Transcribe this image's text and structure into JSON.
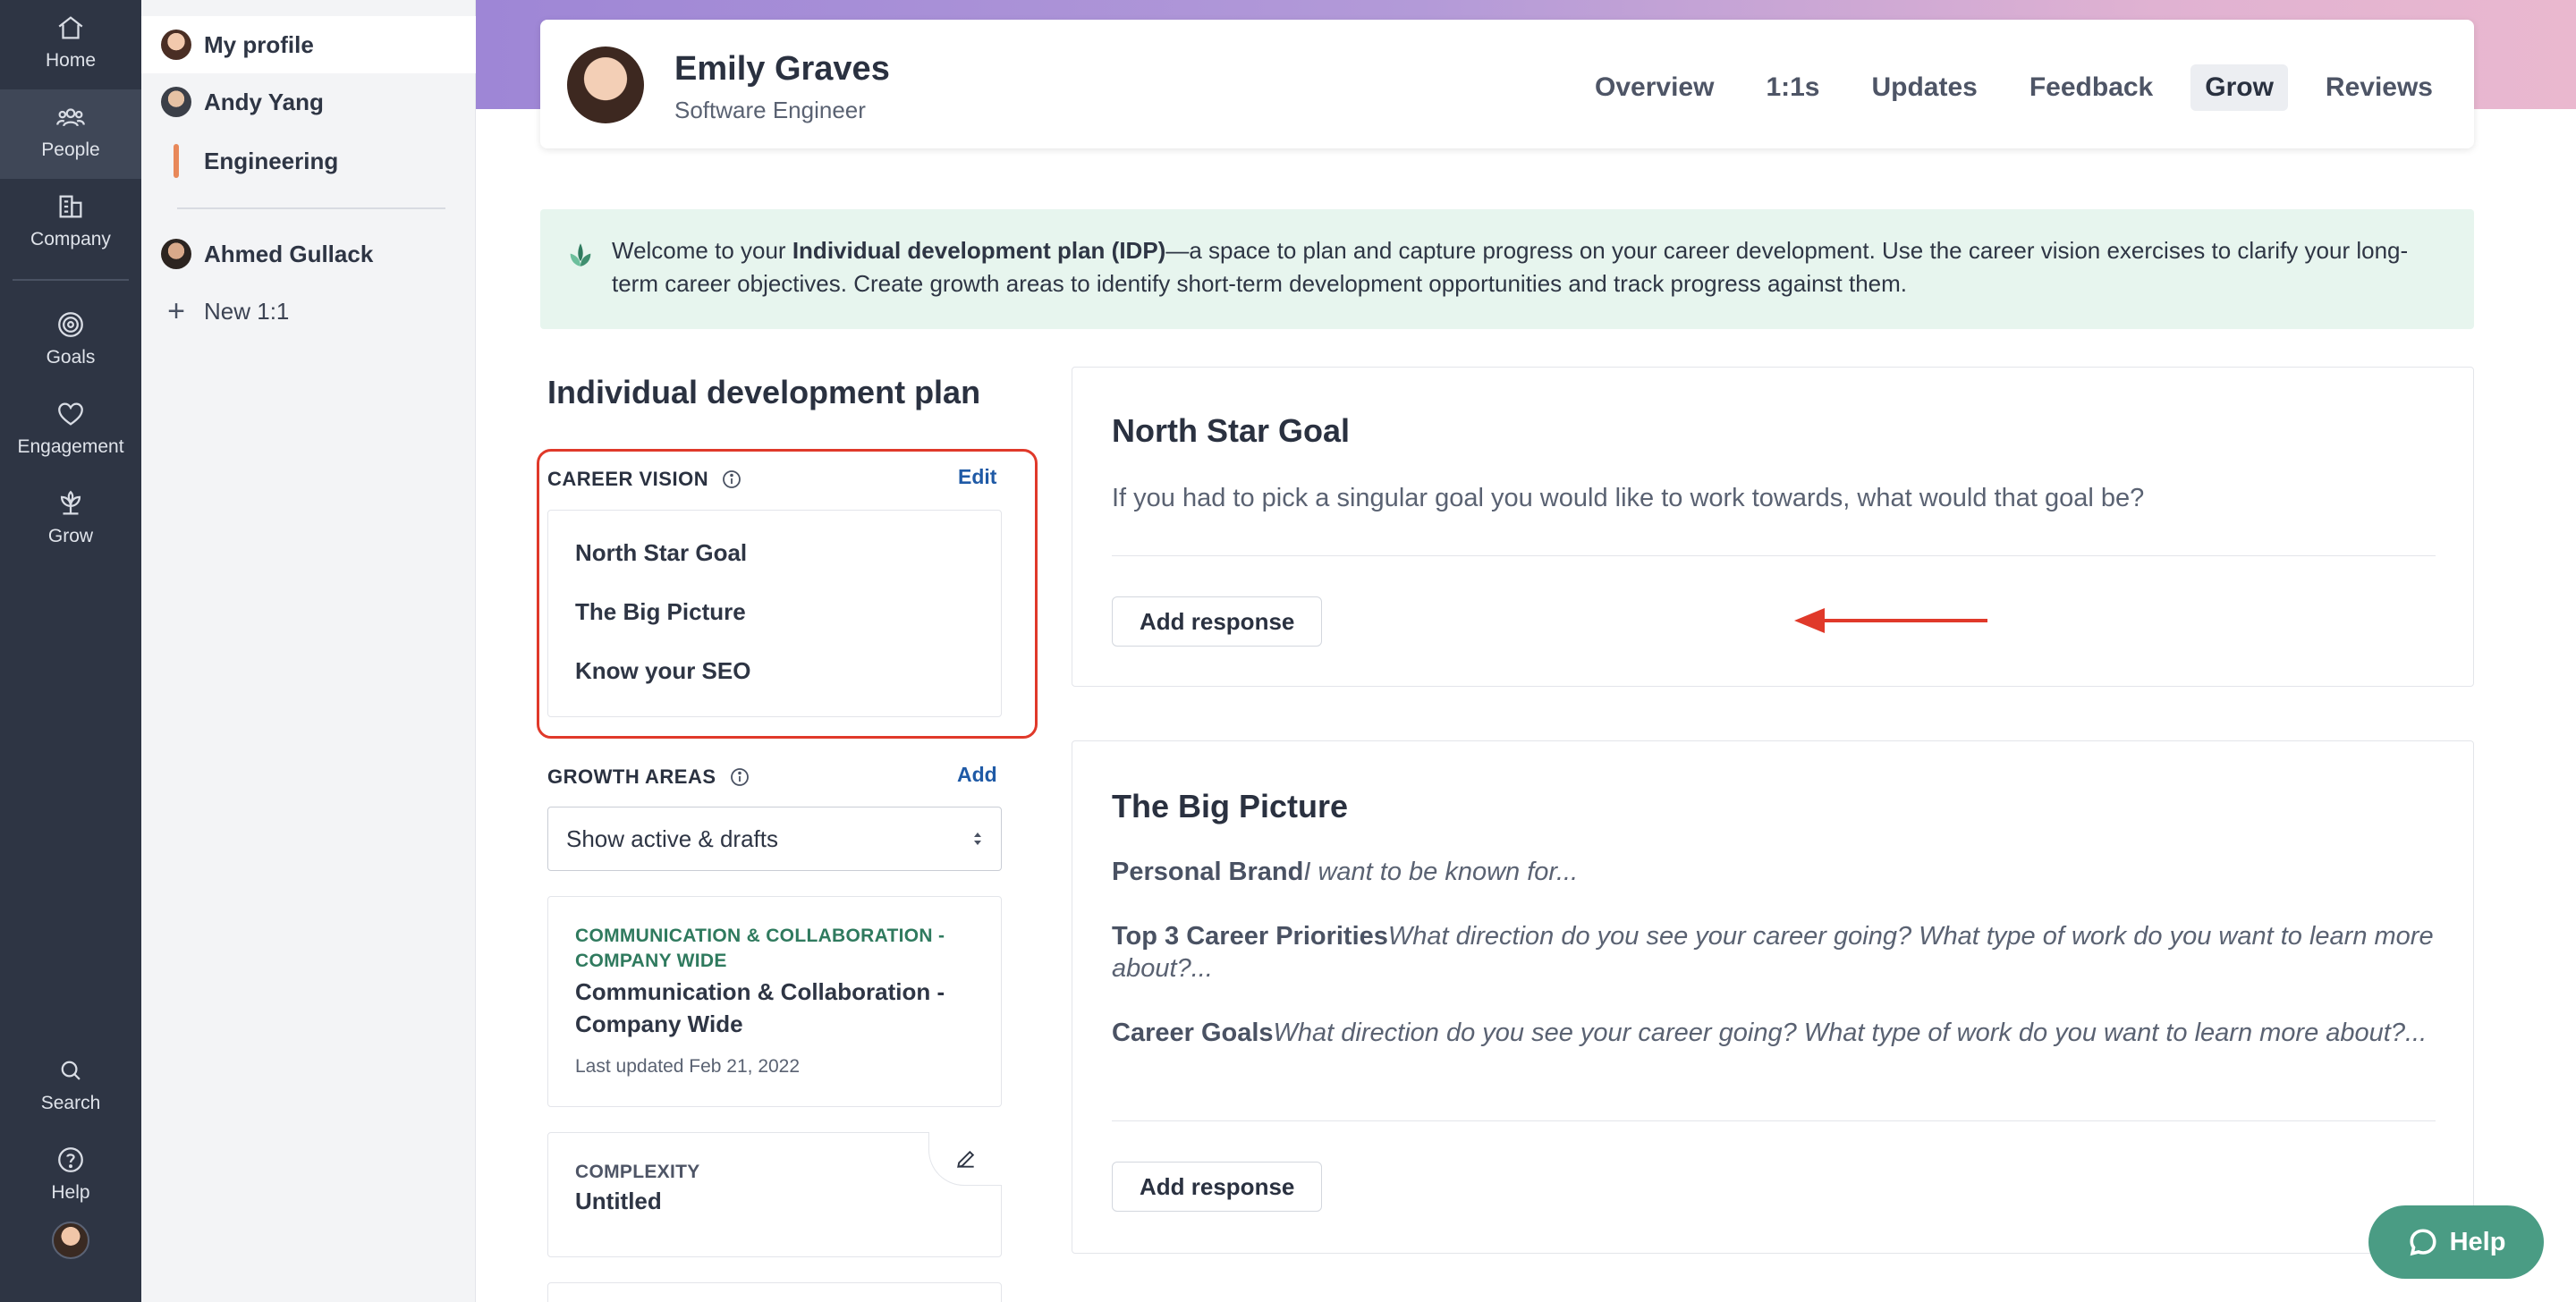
{
  "rail": {
    "home": "Home",
    "people": "People",
    "company": "Company",
    "goals": "Goals",
    "engagement": "Engagement",
    "grow": "Grow",
    "search": "Search",
    "help": "Help"
  },
  "subnav": {
    "my_profile": "My profile",
    "andy": "Andy Yang",
    "engineering": "Engineering",
    "ahmed": "Ahmed Gullack",
    "new_one_on_one": "New 1:1"
  },
  "profile": {
    "name": "Emily Graves",
    "role": "Software Engineer",
    "tabs": [
      "Overview",
      "1:1s",
      "Updates",
      "Feedback",
      "Grow",
      "Reviews"
    ],
    "active_tab": "Grow"
  },
  "welcome": {
    "prefix": "Welcome to your ",
    "bold": "Individual development plan (IDP)",
    "suffix": "—a space to plan and capture progress on your career development. Use the career vision exercises to clarify your long-term career objectives. Create growth areas to identify short-term development opportunities and track progress against them."
  },
  "idp": {
    "title": "Individual development plan",
    "career_vision": {
      "heading": "CAREER VISION",
      "edit": "Edit",
      "items": [
        "North Star Goal",
        "The Big Picture",
        "Know your SEO"
      ]
    },
    "growth_areas": {
      "heading": "GROWTH AREAS",
      "add": "Add",
      "filter": "Show active & drafts",
      "cards": [
        {
          "tag": "COMMUNICATION & COLLABORATION - COMPANY WIDE",
          "title": "Communication & Collaboration - Company Wide",
          "meta": "Last updated Feb 21, 2022",
          "tag_color": "#2f7a5e"
        },
        {
          "tag": "COMPLEXITY",
          "title": "Untitled",
          "tag_color": "#4e5566"
        }
      ]
    }
  },
  "north_star": {
    "title": "North Star Goal",
    "prompt": "If you had to pick a singular goal you would like to work towards, what would that goal be?",
    "button": "Add response"
  },
  "big_picture": {
    "title": "The Big Picture",
    "rows": [
      {
        "label": "Personal Brand",
        "prompt": "I want to be known for..."
      },
      {
        "label": "Top 3 Career Priorities",
        "prompt": "What direction do you see your career going? What type of work do you want to learn more about?..."
      },
      {
        "label": "Career Goals",
        "prompt": "What direction do you see your career going? What type of work do you want to learn more about?..."
      }
    ],
    "button": "Add response"
  },
  "help_button": "Help",
  "colors": {
    "rail_bg": "#2e3544",
    "accent_link": "#1f5aa6",
    "highlight_red": "#e0392a",
    "help_green": "#4a9c84",
    "welcome_bg": "#e7f5ee"
  }
}
